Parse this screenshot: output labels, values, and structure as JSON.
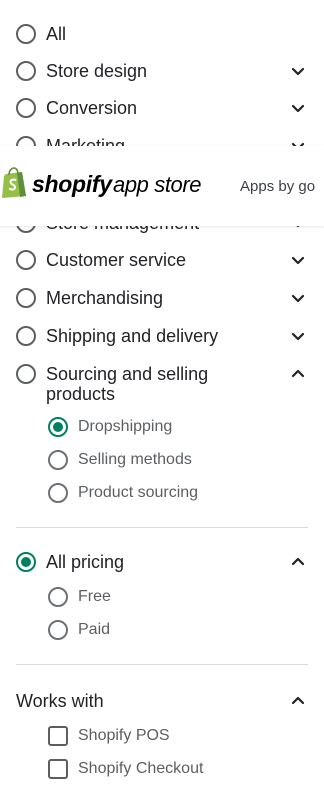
{
  "categories": [
    {
      "label": "All",
      "expand": "none",
      "checked": false
    },
    {
      "label": "Store design",
      "expand": "down",
      "checked": false
    },
    {
      "label": "Conversion",
      "expand": "down",
      "checked": false
    },
    {
      "label": "Marketing",
      "expand": "down",
      "checked": false
    },
    {
      "label": "Store management",
      "expand": "down",
      "checked": false
    },
    {
      "label": "Customer service",
      "expand": "down",
      "checked": false
    },
    {
      "label": "Merchandising",
      "expand": "down",
      "checked": false
    },
    {
      "label": "Shipping and delivery",
      "expand": "down",
      "checked": false
    },
    {
      "label": "Sourcing and selling products",
      "expand": "up",
      "checked": false
    }
  ],
  "sourcing_sub": [
    {
      "label": "Dropshipping",
      "checked": true
    },
    {
      "label": "Selling methods",
      "checked": false
    },
    {
      "label": "Product sourcing",
      "checked": false
    }
  ],
  "pricing": {
    "label": "All pricing",
    "checked": true,
    "options": [
      {
        "label": "Free",
        "checked": false
      },
      {
        "label": "Paid",
        "checked": false
      }
    ]
  },
  "works_with": {
    "title": "Works with",
    "options": [
      {
        "label": "Shopify POS",
        "checked": false
      },
      {
        "label": "Shopify Checkout",
        "checked": false
      }
    ]
  },
  "header": {
    "logo_word": "shopify",
    "logo_sub": "app store",
    "apps_by": "Apps by go"
  },
  "colors": {
    "accent": "#008060",
    "logo_green": "#95bf47",
    "text": "#212326",
    "muted": "#5c5f62"
  },
  "icons": {
    "expand": "chevron-down-icon",
    "collapse": "chevron-up-icon",
    "logo": "shopify-bag-icon"
  }
}
